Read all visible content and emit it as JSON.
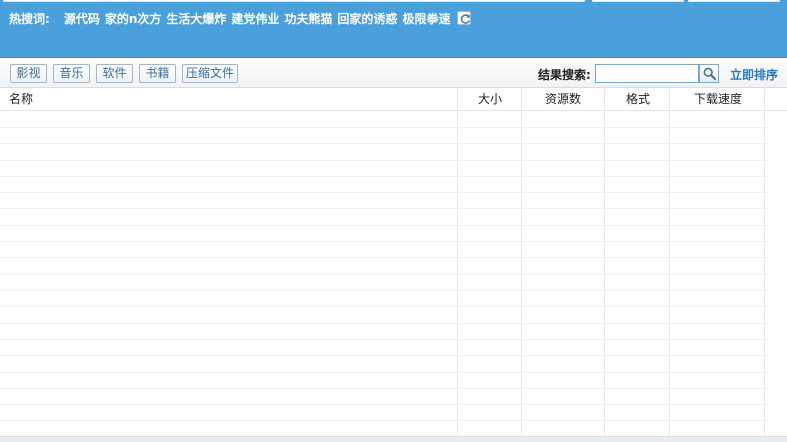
{
  "hotbar": {
    "label": "热搜词:",
    "words": [
      "源代码",
      "家的n次方",
      "生活大爆炸",
      "建党伟业",
      "功夫熊猫",
      "回家的诱惑",
      "极限拳速"
    ]
  },
  "toolbar": {
    "categories": [
      "影视",
      "音乐",
      "软件",
      "书籍",
      "压缩文件"
    ],
    "search_label": "结果搜索:",
    "search_value": "",
    "sort_label": "立即排序"
  },
  "table": {
    "columns": [
      "名称",
      "大小",
      "资源数",
      "格式",
      "下载速度"
    ],
    "rows": []
  },
  "colors": {
    "header_blue": "#4aa0dc",
    "link_blue": "#2a78c0",
    "button_text": "#3a6f9e"
  }
}
